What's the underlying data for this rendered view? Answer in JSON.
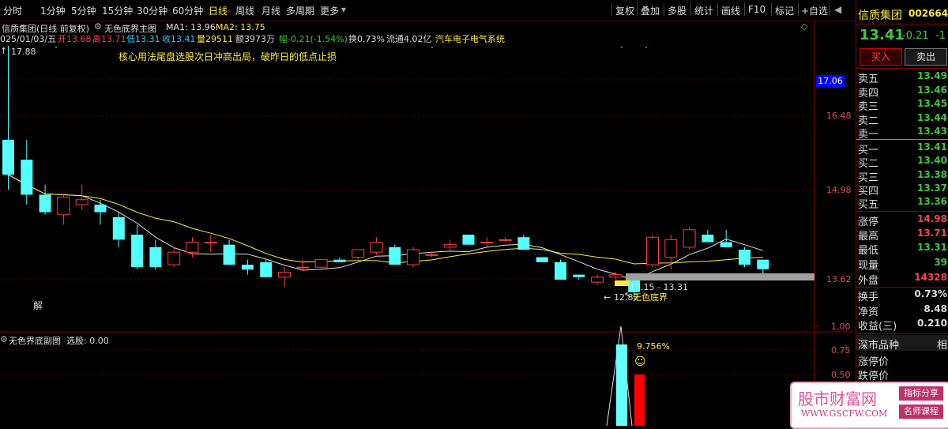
{
  "toolbar": {
    "periods": [
      "分时",
      "1分钟",
      "5分钟",
      "15分钟",
      "30分钟",
      "60分钟",
      "日线",
      "周线",
      "月线",
      "多周期",
      "更多"
    ],
    "more_arrow": "▾",
    "tools": [
      "复权",
      "叠加",
      "多股",
      "统计",
      "画线",
      "F10",
      "标记",
      "+自选"
    ],
    "back_arrow": "◀"
  },
  "header": {
    "stock_title": "信质集团(日线 前复权)",
    "indicator_name": "无色底界主图",
    "ma1": "MA1: 13.96",
    "ma2": "MA2: 13.75",
    "date": "025/01/03/五",
    "open": "开13.68",
    "high": "高13.71",
    "low": "低13.31",
    "close": "收13.41",
    "volume": "量29511",
    "amount": "额3973万",
    "change": "幅-0.21(-1.54%)",
    "turnover": "换0.73%",
    "float_cap": "流通4.02亿",
    "sector": "汽车电子电气系统",
    "strategy_text": "核心用法尾盘选股次日冲高出局，破昨日的低点止损"
  },
  "main_chart_labels": {
    "max_price": "17.88",
    "min_price": "12.82",
    "signal_range": "13.15 - 13.31",
    "signal_name": "无色底界",
    "jie": "解"
  },
  "y_axis": [
    "17.06",
    "16.48",
    "14.98",
    "13.62"
  ],
  "sub_chart": {
    "title": "无色界底副图",
    "select": "选股: 0.00",
    "y_axis": [
      "1.00",
      "0.75",
      "0.50"
    ],
    "pct_label": "9.756%",
    "smile": "☺"
  },
  "chart_data": {
    "type": "candlestick",
    "candles": [
      {
        "o": 16.0,
        "h": 17.88,
        "l": 15.0,
        "c": 15.3
      },
      {
        "o": 15.6,
        "h": 16.0,
        "l": 14.7,
        "c": 14.9
      },
      {
        "o": 14.9,
        "h": 15.1,
        "l": 14.5,
        "c": 14.55
      },
      {
        "o": 14.5,
        "h": 14.9,
        "l": 14.3,
        "c": 14.85
      },
      {
        "o": 14.7,
        "h": 15.1,
        "l": 14.6,
        "c": 14.8
      },
      {
        "o": 14.7,
        "h": 14.8,
        "l": 14.3,
        "c": 14.55
      },
      {
        "o": 14.45,
        "h": 14.55,
        "l": 13.85,
        "c": 14.0
      },
      {
        "o": 14.1,
        "h": 14.3,
        "l": 13.4,
        "c": 13.45
      },
      {
        "o": 13.85,
        "h": 14.0,
        "l": 13.4,
        "c": 13.45
      },
      {
        "o": 13.5,
        "h": 13.85,
        "l": 13.45,
        "c": 13.75
      },
      {
        "o": 13.75,
        "h": 14.05,
        "l": 13.65,
        "c": 13.95
      },
      {
        "o": 13.95,
        "h": 14.1,
        "l": 13.75,
        "c": 13.95
      },
      {
        "o": 13.9,
        "h": 14.0,
        "l": 13.5,
        "c": 13.5
      },
      {
        "o": 13.5,
        "h": 13.6,
        "l": 13.3,
        "c": 13.4
      },
      {
        "o": 13.55,
        "h": 13.6,
        "l": 13.25,
        "c": 13.25
      },
      {
        "o": 13.25,
        "h": 13.45,
        "l": 13.05,
        "c": 13.35
      },
      {
        "o": 13.45,
        "h": 13.6,
        "l": 13.4,
        "c": 13.45
      },
      {
        "o": 13.45,
        "h": 13.6,
        "l": 13.4,
        "c": 13.6
      },
      {
        "o": 13.6,
        "h": 13.65,
        "l": 13.55,
        "c": 13.55
      },
      {
        "o": 13.65,
        "h": 13.8,
        "l": 13.6,
        "c": 13.8
      },
      {
        "o": 13.75,
        "h": 14.05,
        "l": 13.7,
        "c": 13.95
      },
      {
        "o": 13.85,
        "h": 13.9,
        "l": 13.5,
        "c": 13.5
      },
      {
        "o": 13.5,
        "h": 13.85,
        "l": 13.45,
        "c": 13.8
      },
      {
        "o": 13.7,
        "h": 13.75,
        "l": 13.65,
        "c": 13.7
      },
      {
        "o": 13.85,
        "h": 14.0,
        "l": 13.8,
        "c": 13.9
      },
      {
        "o": 14.1,
        "h": 14.1,
        "l": 13.9,
        "c": 13.9
      },
      {
        "o": 13.95,
        "h": 14.05,
        "l": 13.85,
        "c": 13.95
      },
      {
        "o": 14.0,
        "h": 14.05,
        "l": 13.95,
        "c": 14.0
      },
      {
        "o": 14.05,
        "h": 14.1,
        "l": 13.8,
        "c": 13.8
      },
      {
        "o": 13.65,
        "h": 13.65,
        "l": 13.55,
        "c": 13.55
      },
      {
        "o": 13.55,
        "h": 13.6,
        "l": 13.2,
        "c": 13.2
      },
      {
        "o": 13.3,
        "h": 13.3,
        "l": 13.2,
        "c": 13.25
      },
      {
        "o": 13.15,
        "h": 13.3,
        "l": 13.1,
        "c": 13.25
      },
      {
        "o": 13.25,
        "h": 13.35,
        "l": 13.2,
        "c": 13.3
      },
      {
        "o": 13.3,
        "h": 13.3,
        "l": 12.82,
        "c": 12.95
      },
      {
        "o": 13.5,
        "h": 14.1,
        "l": 13.45,
        "c": 14.05
      },
      {
        "o": 13.65,
        "h": 14.1,
        "l": 13.4,
        "c": 14.0
      },
      {
        "o": 13.85,
        "h": 14.25,
        "l": 13.8,
        "c": 14.2
      },
      {
        "o": 14.1,
        "h": 14.2,
        "l": 13.95,
        "c": 13.95
      },
      {
        "o": 13.95,
        "h": 14.2,
        "l": 13.85,
        "c": 13.85
      },
      {
        "o": 13.8,
        "h": 13.85,
        "l": 13.45,
        "c": 13.5
      },
      {
        "o": 13.6,
        "h": 13.6,
        "l": 13.31,
        "c": 13.41
      }
    ],
    "ma1_label": "MA1",
    "ma2_label": "MA2"
  },
  "panel": {
    "name": "信质集团",
    "code": "002664",
    "price": "13.41",
    "change": "-0.21",
    "pct": "-1",
    "buy_btn": "买入",
    "sell_btn": "卖出",
    "asks": [
      {
        "label": "卖五",
        "price": "13.49"
      },
      {
        "label": "卖四",
        "price": "13.46"
      },
      {
        "label": "卖三",
        "price": "13.45"
      },
      {
        "label": "卖二",
        "price": "13.44"
      },
      {
        "label": "卖一",
        "price": "13.43"
      }
    ],
    "bids": [
      {
        "label": "买一",
        "price": "13.41"
      },
      {
        "label": "买二",
        "price": "13.40"
      },
      {
        "label": "买三",
        "price": "13.38"
      },
      {
        "label": "买四",
        "price": "13.37"
      },
      {
        "label": "买五",
        "price": "13.36"
      }
    ],
    "stats": [
      {
        "label": "涨停",
        "value": "14.98"
      },
      {
        "label": "最高",
        "value": "13.71"
      },
      {
        "label": "最低",
        "value": "13.31"
      },
      {
        "label": "现量",
        "value": "39"
      },
      {
        "label": "外盘",
        "value": "14328"
      }
    ],
    "stats2": [
      {
        "label": "换手",
        "value": "0.73%"
      },
      {
        "label": "净资",
        "value": "8.48"
      },
      {
        "label": "收益(三)",
        "value": "0.210"
      }
    ],
    "market_type": "深市品种",
    "market_right": "相",
    "limit_up_price": "涨停价",
    "limit_down_price": "跌停价"
  },
  "watermark": {
    "title": "股市财富网",
    "url": "WWW.GSCFW.COM",
    "tag1": "指标分享",
    "tag2": "名师课程"
  }
}
